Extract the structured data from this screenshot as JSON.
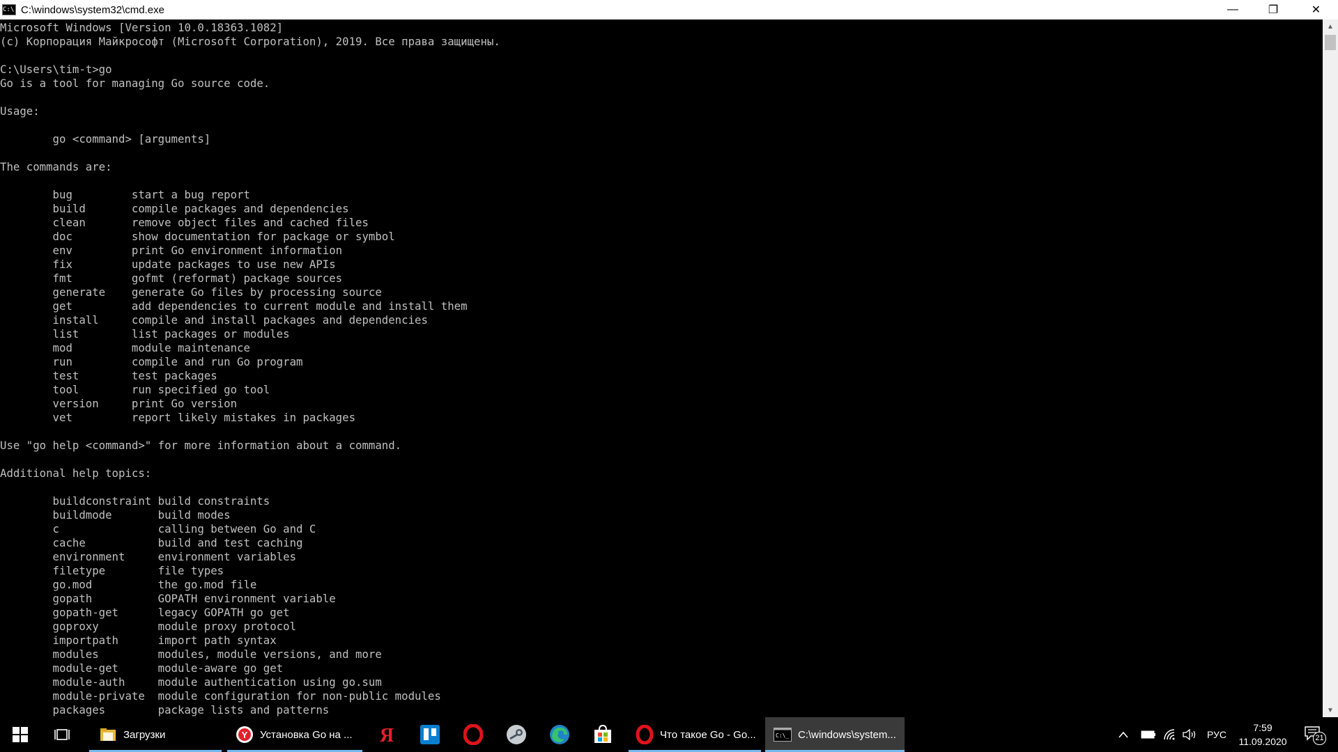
{
  "window": {
    "title": "C:\\windows\\system32\\cmd.exe",
    "icon": "cmd-icon",
    "controls": {
      "minimize": "—",
      "restore": "❐",
      "close": "✕"
    }
  },
  "console": {
    "text": "Microsoft Windows [Version 10.0.18363.1082]\n(c) Корпорация Майкрософт (Microsoft Corporation), 2019. Все права защищены.\n\nC:\\Users\\tim-t>go\nGo is a tool for managing Go source code.\n\nUsage:\n\n        go <command> [arguments]\n\nThe commands are:\n\n        bug         start a bug report\n        build       compile packages and dependencies\n        clean       remove object files and cached files\n        doc         show documentation for package or symbol\n        env         print Go environment information\n        fix         update packages to use new APIs\n        fmt         gofmt (reformat) package sources\n        generate    generate Go files by processing source\n        get         add dependencies to current module and install them\n        install     compile and install packages and dependencies\n        list        list packages or modules\n        mod         module maintenance\n        run         compile and run Go program\n        test        test packages\n        tool        run specified go tool\n        version     print Go version\n        vet         report likely mistakes in packages\n\nUse \"go help <command>\" for more information about a command.\n\nAdditional help topics:\n\n        buildconstraint build constraints\n        buildmode       build modes\n        c               calling between Go and C\n        cache           build and test caching\n        environment     environment variables\n        filetype        file types\n        go.mod          the go.mod file\n        gopath          GOPATH environment variable\n        gopath-get      legacy GOPATH go get\n        goproxy         module proxy protocol\n        importpath      import path syntax\n        modules         modules, module versions, and more\n        module-get      module-aware go get\n        module-auth     module authentication using go.sum\n        module-private  module configuration for non-public modules\n        packages        package lists and patterns"
  },
  "scrollbar": {
    "up": "▲",
    "down": "▼"
  },
  "taskbar": {
    "start_icon": "windows-logo-icon",
    "taskview_icon": "task-view-icon",
    "apps": [
      {
        "label": "Загрузки",
        "icon": "folder-icon"
      },
      {
        "label": "Установка Go на ...",
        "icon": "yandex-browser-icon"
      },
      {
        "label": "",
        "icon": "yandex-icon"
      },
      {
        "label": "",
        "icon": "trello-icon"
      },
      {
        "label": "",
        "icon": "opera-icon"
      },
      {
        "label": "",
        "icon": "steam-icon"
      },
      {
        "label": "",
        "icon": "edge-icon"
      },
      {
        "label": "",
        "icon": "store-icon"
      },
      {
        "label": "Что такое Go - Go...",
        "icon": "opera-icon"
      },
      {
        "label": "C:\\windows\\system...",
        "icon": "cmd-icon"
      }
    ],
    "tray": {
      "language": "РУС",
      "time": "7:59",
      "date": "11.09.2020",
      "notifications_count": "21"
    },
    "colors": {
      "active_underline": "#76b9ed",
      "background": "#000000"
    }
  }
}
